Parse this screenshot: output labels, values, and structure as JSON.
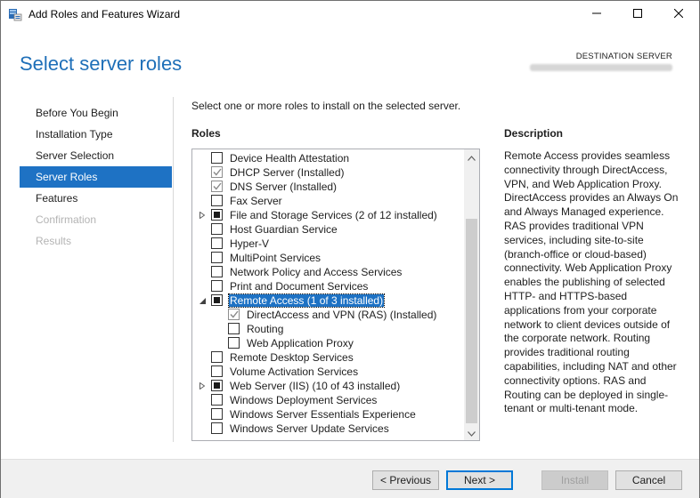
{
  "window": {
    "title": "Add Roles and Features Wizard",
    "page_title": "Select server roles",
    "destination_label": "DESTINATION SERVER"
  },
  "nav": {
    "items": [
      {
        "label": "Before You Begin",
        "state": "normal"
      },
      {
        "label": "Installation Type",
        "state": "normal"
      },
      {
        "label": "Server Selection",
        "state": "normal"
      },
      {
        "label": "Server Roles",
        "state": "active"
      },
      {
        "label": "Features",
        "state": "normal"
      },
      {
        "label": "Confirmation",
        "state": "disabled"
      },
      {
        "label": "Results",
        "state": "disabled"
      }
    ]
  },
  "content": {
    "instruction": "Select one or more roles to install on the selected server.",
    "roles_heading": "Roles",
    "description_heading": "Description",
    "description_text": "Remote Access provides seamless connectivity through DirectAccess, VPN, and Web Application Proxy. DirectAccess provides an Always On and Always Managed experience. RAS provides traditional VPN services, including site-to-site (branch-office or cloud-based) connectivity. Web Application Proxy enables the publishing of selected HTTP- and HTTPS-based applications from your corporate network to client devices outside of the corporate network. Routing provides traditional routing capabilities, including NAT and other connectivity options. RAS and Routing can be deployed in single-tenant or multi-tenant mode."
  },
  "roles": [
    {
      "label": "Device Health Attestation",
      "state": "unchecked",
      "level": 0,
      "expander": "none"
    },
    {
      "label": "DHCP Server (Installed)",
      "state": "checked",
      "level": 0,
      "expander": "none"
    },
    {
      "label": "DNS Server (Installed)",
      "state": "checked",
      "level": 0,
      "expander": "none"
    },
    {
      "label": "Fax Server",
      "state": "unchecked",
      "level": 0,
      "expander": "none"
    },
    {
      "label": "File and Storage Services (2 of 12 installed)",
      "state": "partial",
      "level": 0,
      "expander": "collapsed"
    },
    {
      "label": "Host Guardian Service",
      "state": "unchecked",
      "level": 0,
      "expander": "none"
    },
    {
      "label": "Hyper-V",
      "state": "unchecked",
      "level": 0,
      "expander": "none"
    },
    {
      "label": "MultiPoint Services",
      "state": "unchecked",
      "level": 0,
      "expander": "none"
    },
    {
      "label": "Network Policy and Access Services",
      "state": "unchecked",
      "level": 0,
      "expander": "none"
    },
    {
      "label": "Print and Document Services",
      "state": "unchecked",
      "level": 0,
      "expander": "none"
    },
    {
      "label": "Remote Access (1 of 3 installed)",
      "state": "partial",
      "level": 0,
      "expander": "expanded",
      "selected": true
    },
    {
      "label": "DirectAccess and VPN (RAS) (Installed)",
      "state": "checked",
      "level": 1,
      "expander": "none"
    },
    {
      "label": "Routing",
      "state": "unchecked",
      "level": 1,
      "expander": "none"
    },
    {
      "label": "Web Application Proxy",
      "state": "unchecked",
      "level": 1,
      "expander": "none"
    },
    {
      "label": "Remote Desktop Services",
      "state": "unchecked",
      "level": 0,
      "expander": "none"
    },
    {
      "label": "Volume Activation Services",
      "state": "unchecked",
      "level": 0,
      "expander": "none"
    },
    {
      "label": "Web Server (IIS) (10 of 43 installed)",
      "state": "partial",
      "level": 0,
      "expander": "collapsed"
    },
    {
      "label": "Windows Deployment Services",
      "state": "unchecked",
      "level": 0,
      "expander": "none"
    },
    {
      "label": "Windows Server Essentials Experience",
      "state": "unchecked",
      "level": 0,
      "expander": "none"
    },
    {
      "label": "Windows Server Update Services",
      "state": "unchecked",
      "level": 0,
      "expander": "none"
    }
  ],
  "buttons": {
    "previous": "< Previous",
    "next": "Next >",
    "install": "Install",
    "cancel": "Cancel"
  },
  "colors": {
    "accent": "#1e72c4",
    "title_blue": "#1e6fb8",
    "disabled_text": "#b4b4b4"
  }
}
